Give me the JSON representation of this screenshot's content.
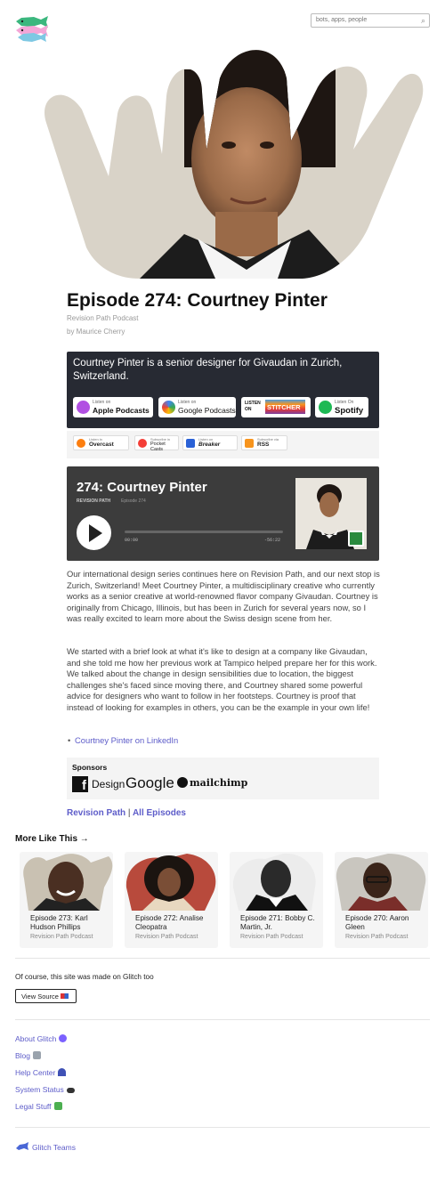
{
  "header": {
    "search_placeholder": "bots, apps, people",
    "search_icon": "magnifier-icon"
  },
  "episode": {
    "title": "Episode 274: Courtney Pinter",
    "show": "Revision Path Podcast",
    "byline": "by Maurice Cherry"
  },
  "embed": {
    "description": "Courtney Pinter is a senior designer for Givaudan in Zurich, Switzerland.",
    "badges": [
      {
        "small": "Listen on",
        "big": "Apple Podcasts"
      },
      {
        "small": "Listen on",
        "big": "Google Podcasts"
      },
      {
        "small": "LISTEN ON",
        "big": "STITCHER"
      },
      {
        "small": "Listen On",
        "big": "Spotify"
      }
    ]
  },
  "apps": [
    {
      "small": "Listen in",
      "big": "Overcast"
    },
    {
      "small": "Subscribe in",
      "big": "Pocket Casts"
    },
    {
      "small": "Listen on",
      "big": "Breaker"
    },
    {
      "small": "Subscribe via",
      "big": "RSS"
    }
  ],
  "player": {
    "title": "274: Courtney Pinter",
    "show": "REVISION PATH",
    "episode": "Episode 274",
    "time_elapsed": "00:00",
    "time_remaining": "-56:22"
  },
  "body": {
    "para1": "Our international design series continues here on Revision Path, and our next stop is Zurich, Switzerland! Meet Courtney Pinter, a multidisciplinary creative who currently works as a senior creative at world-renowned flavor company Givaudan. Courtney is originally from Chicago, Illinois, but has been in Zurich for several years now, so I was really excited to learn more about the Swiss design scene from her.",
    "para2": "We started with a brief look at what it's like to design at a company like Givaudan, and she told me how her previous work at Tampico helped prepare her for this work. We talked about the change in design sensibilities due to location, the biggest challenges she's faced since moving there, and Courtney shared some powerful advice for designers who want to follow in her footsteps. Courtney is proof that instead of looking for examples in others, you can be the example in your own life!",
    "linkedin": "Courtney Pinter on LinkedIn"
  },
  "sponsors": {
    "heading": "Sponsors",
    "fb_glyph": "f",
    "design": "Design",
    "google": "Google",
    "mailchimp": "mailchimp"
  },
  "bottom_links": {
    "revision_path": "Revision Path",
    "separator": "|",
    "all_episodes": "All Episodes"
  },
  "more_like_this": {
    "heading": "More Like This →",
    "cards": [
      {
        "title": "Episode 273: Karl Hudson Phillips",
        "show": "Revision Path Podcast"
      },
      {
        "title": "Episode 272: Analise Cleopatra",
        "show": "Revision Path Podcast"
      },
      {
        "title": "Episode 271: Bobby C. Martin, Jr.",
        "show": "Revision Path Podcast"
      },
      {
        "title": "Episode 270: Aaron Gleen",
        "show": "Revision Path Podcast"
      }
    ]
  },
  "footer": {
    "made_on": "Of course, this site was made on Glitch too",
    "view_source": "View Source",
    "links": [
      {
        "label": "About Glitch",
        "icon": "glitch-emoji-icon",
        "color": "#7b61ff"
      },
      {
        "label": "Blog",
        "icon": "newspaper-icon",
        "color": "#9aa3ad"
      },
      {
        "label": "Help Center",
        "icon": "umbrella-icon",
        "color": "#3f51b5"
      },
      {
        "label": "System Status",
        "icon": "status-icon",
        "color": "#333333"
      },
      {
        "label": "Legal Stuff",
        "icon": "legal-icon",
        "color": "#4caf50"
      }
    ],
    "teams": "Glitch Teams"
  },
  "colors": {
    "link": "#5d5cc9",
    "embed_bg": "#272a33",
    "player_bg": "#3c3c3c"
  }
}
